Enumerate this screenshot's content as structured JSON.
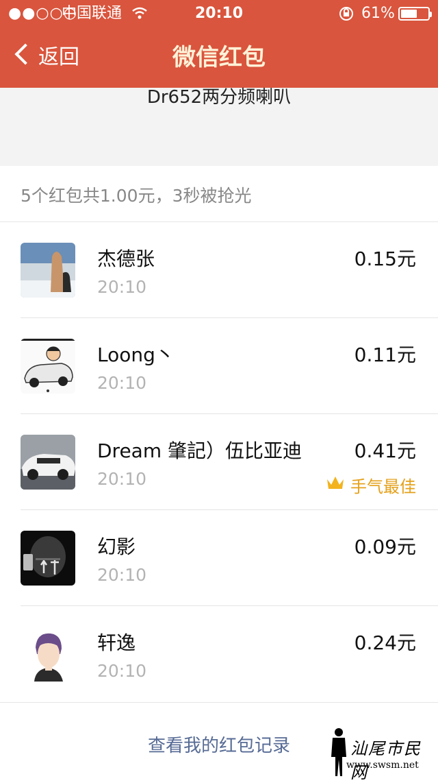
{
  "status": {
    "signal": "●●○○○",
    "carrier": "中国联通",
    "time": "20:10",
    "battery": "61%",
    "battery_level": 0.61
  },
  "nav": {
    "back_label": "返回",
    "title": "微信红包"
  },
  "header": {
    "sender": "Dr652两分频喇叭"
  },
  "summary": "5个红包共1.00元，3秒被抢光",
  "records": [
    {
      "name": "杰德张",
      "time": "20:10",
      "amount": "0.15元"
    },
    {
      "name": "Loong丶",
      "time": "20:10",
      "amount": "0.11元"
    },
    {
      "name": "Dream 肇記）伍比亚迪",
      "time": "20:10",
      "amount": "0.41元",
      "badge": "手气最佳"
    },
    {
      "name": "幻影",
      "time": "20:10",
      "amount": "0.09元"
    },
    {
      "name": "轩逸",
      "time": "20:10",
      "amount": "0.24元"
    }
  ],
  "footer": {
    "link": "查看我的红包记录"
  },
  "watermark": {
    "text": "汕尾市民网",
    "url": "www.swsm.net"
  },
  "icons": {
    "wifi": "wifi-icon",
    "lock": "rotation-lock-icon",
    "crown": "crown-icon"
  },
  "colors": {
    "nav_bg": "#d9553d",
    "nav_title": "#fff2d8",
    "link": "#576b95",
    "best": "#e4a11b"
  }
}
